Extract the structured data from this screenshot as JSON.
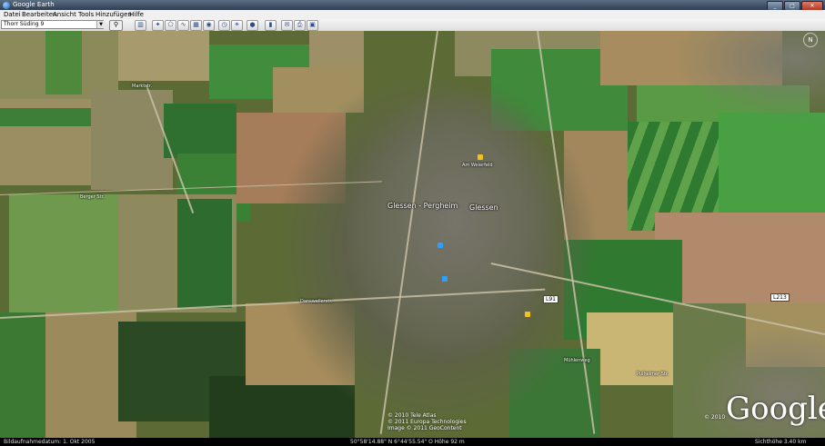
{
  "window": {
    "title": "Google Earth",
    "minimize": "_",
    "maximize": "□",
    "close": "✕"
  },
  "menu": [
    "Datei",
    "Bearbeiten",
    "Ansicht",
    "Tools",
    "Hinzufügen",
    "Hilfe"
  ],
  "search": {
    "value": "Thorr Süding 9",
    "dropdown_icon": "chevron-down-icon",
    "button_icon": "search-icon"
  },
  "toolbar_icons": [
    "sidebar-icon",
    "placemark-icon",
    "polygon-icon",
    "path-icon",
    "overlay-icon",
    "tour-icon",
    "historical-imagery-icon",
    "sun-icon",
    "planets-icon",
    "ruler-icon",
    "email-icon",
    "print-icon",
    "save-image-icon"
  ],
  "map": {
    "place_labels": [
      "Glessen - Pergheim",
      "Glessen"
    ],
    "road_labels": [
      "L91",
      "L213"
    ],
    "street_labels": [
      "Marktstr.",
      "Berger Str.",
      "Am Weierfeld",
      "Mühlenweg",
      "Dansweilerstr.",
      "Pulheimer Str."
    ],
    "watermark": "Google",
    "copyright": [
      "© 2010 Tele Atlas",
      "© 2011 Europa Technologies",
      "Image © 2011 GeoContent",
      "© 2010"
    ],
    "compass": "N"
  },
  "status": {
    "imagery_date": "Bildaufnahmedatum: 1. Okt 2005",
    "coords": "50°58'14.88\" N   6°44'55.54\" O   Höhe  92 m",
    "eye_alt": "Sichthöhe   3.40 km"
  }
}
